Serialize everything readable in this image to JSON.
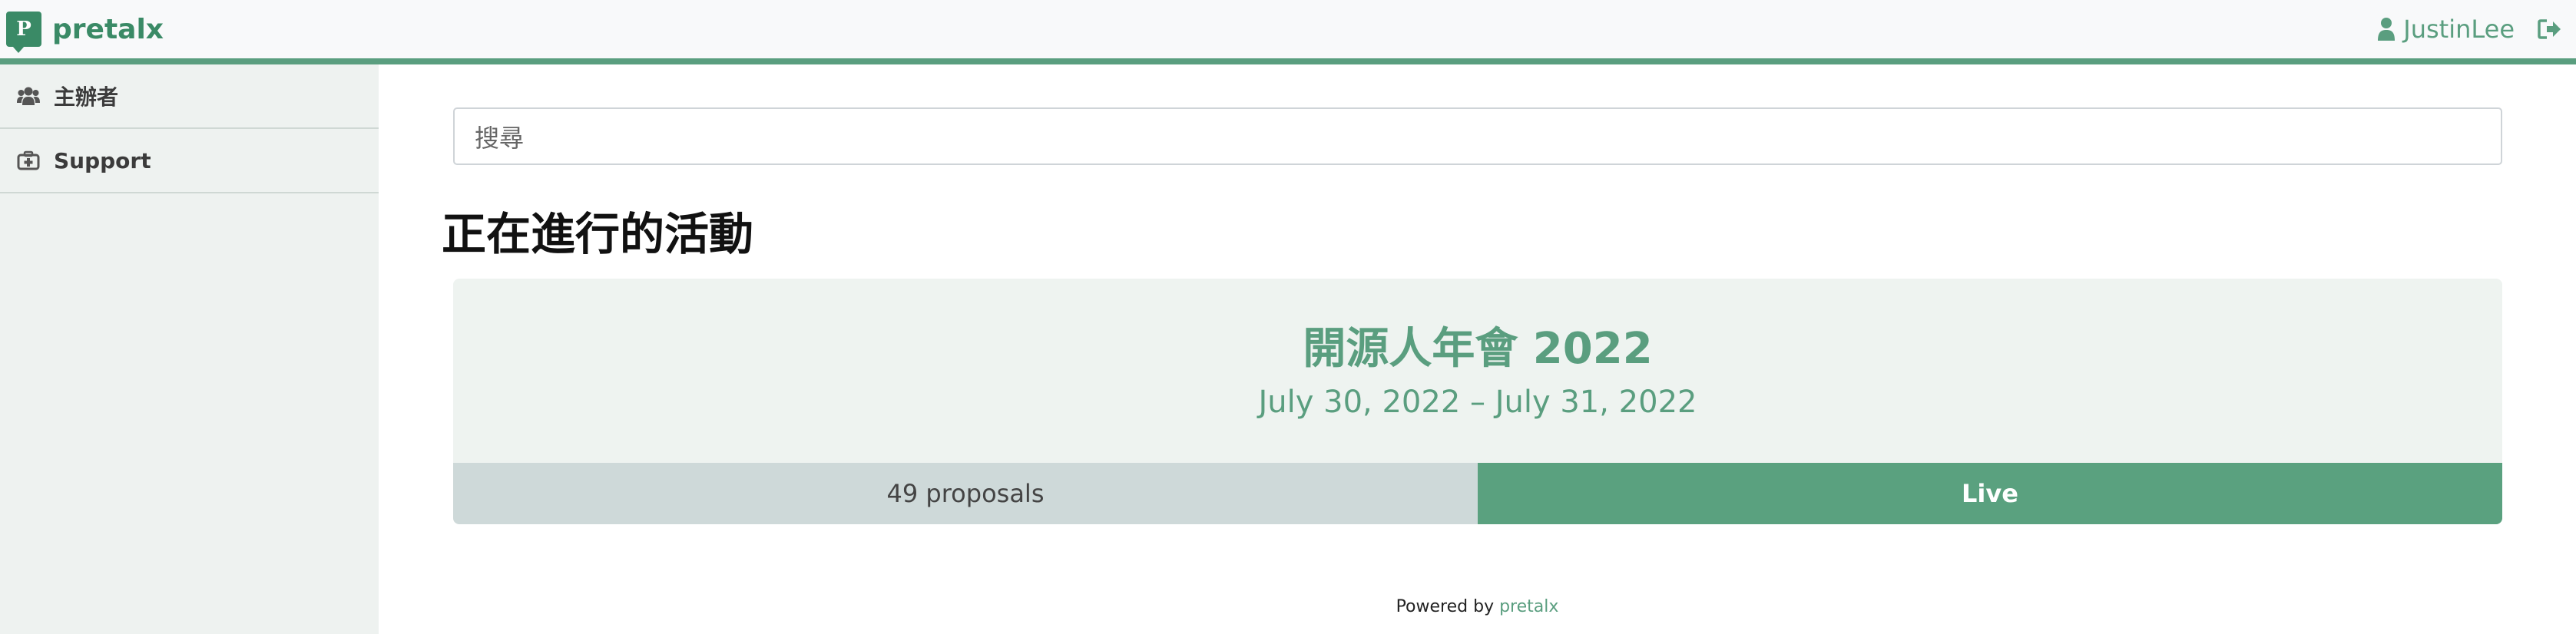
{
  "header": {
    "brand_name": "pretalx",
    "brand_letter": "P",
    "username": "JustinLee",
    "icons": {
      "user": "user-icon",
      "logout": "logout-icon"
    },
    "accent_color": "#5a9e7f"
  },
  "sidebar": {
    "items": [
      {
        "label": "主辦者",
        "icon": "users-icon"
      },
      {
        "label": "Support",
        "icon": "first-aid-kit-icon"
      }
    ]
  },
  "search": {
    "placeholder": "搜尋"
  },
  "main": {
    "heading": "正在進行的活動",
    "events": [
      {
        "title": "開源人年會 2022",
        "dates": "July 30, 2022 – July 31, 2022",
        "proposals": "49 proposals",
        "status": "Live"
      }
    ]
  },
  "footer": {
    "prefix": "Powered by",
    "link": "pretalx"
  }
}
